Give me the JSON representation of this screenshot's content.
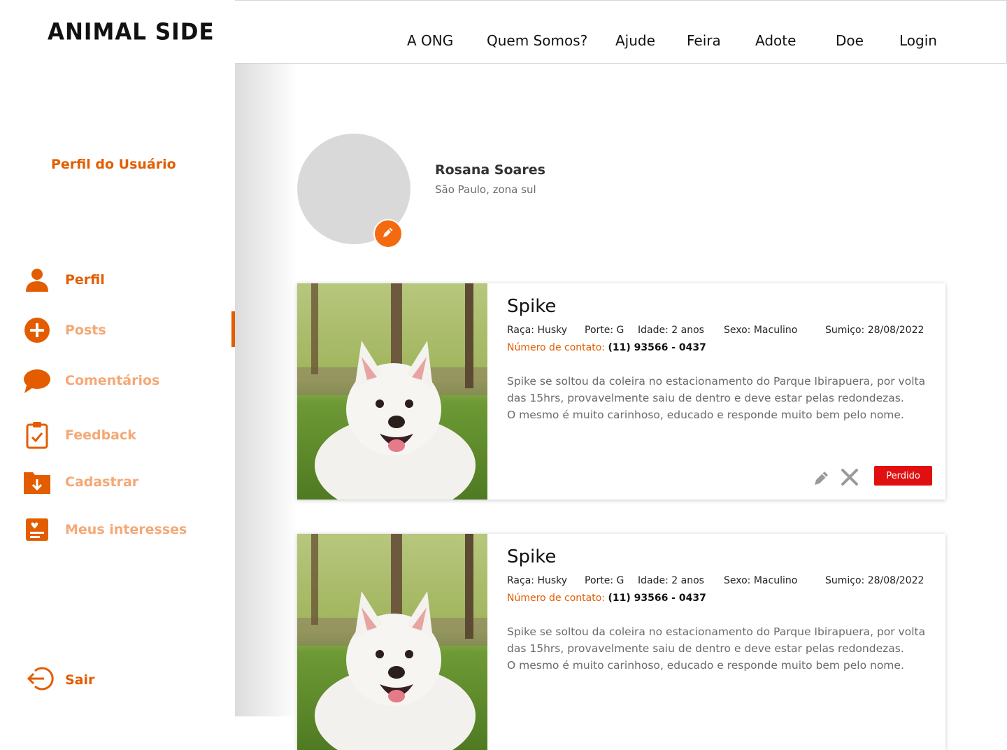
{
  "app": {
    "logo": "ANIMAL SIDE"
  },
  "sidebar": {
    "title": "Perfil do Usuário",
    "items": [
      {
        "label": "Perfil",
        "icon": "user-icon",
        "active": true
      },
      {
        "label": "Posts",
        "icon": "plus-circle-icon"
      },
      {
        "label": "Comentários",
        "icon": "chat-bubble-icon"
      },
      {
        "label": "Feedback",
        "icon": "clipboard-check-icon"
      },
      {
        "label": "Cadastrar",
        "icon": "folder-download-icon"
      },
      {
        "label": "Meus interesses",
        "icon": "heart-list-icon"
      }
    ],
    "exit_label": "Sair"
  },
  "topnav": [
    "A ONG",
    "Quem Somos?",
    "Ajude",
    "Feira",
    "Adote",
    "Doe",
    "Login"
  ],
  "user": {
    "name": "Rosana Soares",
    "location": "São Paulo, zona sul"
  },
  "posts": [
    {
      "name": "Spike",
      "breed": "Raça: Husky",
      "size": "Porte: G",
      "age": "Idade: 2 anos",
      "sex": "Sexo: Maculino",
      "missing": "Sumiço: 28/08/2022",
      "contact_label": "Número de contato:",
      "contact_value": "(11) 93566 - 0437",
      "desc": [
        "Spike se soltou da coleira no estacionamento do Parque Ibirapuera, por volta",
        "das 15hrs, provavelmente saiu de dentro e deve estar pelas redondezas.",
        "O mesmo é muito carinhoso, educado e responde muito bem pelo nome."
      ],
      "status": "Perdido"
    },
    {
      "name": "Spike",
      "breed": "Raça: Husky",
      "size": "Porte: G",
      "age": "Idade: 2 anos",
      "sex": "Sexo: Maculino",
      "missing": "Sumiço: 28/08/2022",
      "contact_label": "Número de contato:",
      "contact_value": "(11) 93566 - 0437",
      "desc": [
        "Spike se soltou da coleira no estacionamento do Parque Ibirapuera, por volta",
        "das 15hrs, provavelmente saiu de dentro e deve estar pelas redondezas.",
        "O mesmo é muito carinhoso, educado e responde muito bem pelo nome."
      ]
    }
  ],
  "colors": {
    "accent": "#e35d00",
    "accent_light": "#f4a876",
    "status_red": "#e01010"
  }
}
